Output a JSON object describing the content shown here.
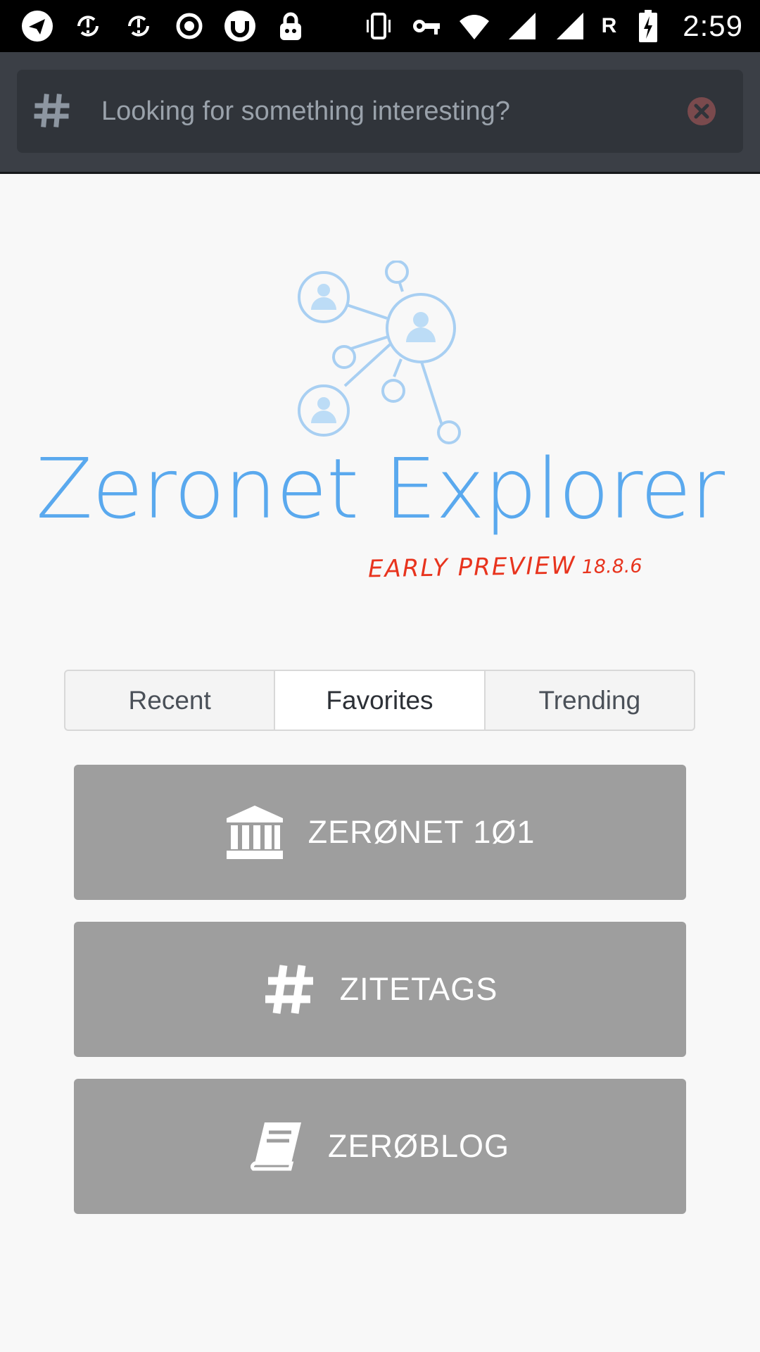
{
  "status_bar": {
    "left_icons": [
      "telegram-icon",
      "sync-icon",
      "sync-icon",
      "record-icon",
      "torrent-icon",
      "privacy-lock-icon"
    ],
    "right_icons": [
      "vibrate-icon",
      "vpn-key-icon",
      "wifi-icon",
      "cell-signal-icon",
      "cell-signal-icon",
      "battery-charging-icon"
    ],
    "roaming": "R",
    "time": "2:59"
  },
  "search": {
    "icon": "hash-icon",
    "placeholder": "Looking for something interesting?",
    "value": "",
    "clear_icon": "close-circle-icon"
  },
  "logo": {
    "title": "Zeronet Explorer",
    "subtitle": "EARLY PREVIEW",
    "version": "18.8.6",
    "graphic": "network-users-icon"
  },
  "tabs": [
    {
      "label": "Recent",
      "active": false
    },
    {
      "label": "Favorites",
      "active": true
    },
    {
      "label": "Trending",
      "active": false
    }
  ],
  "favorites": [
    {
      "label": "ZERØNET 1Ø1",
      "icon": "institution-icon"
    },
    {
      "label": "ZITETAGS",
      "icon": "hashtag-icon"
    },
    {
      "label": "ZERØBLOG",
      "icon": "book-icon"
    }
  ],
  "colors": {
    "status_bar": "#000000",
    "header": "#3b3f46",
    "search_box": "#30343a",
    "logo_blue": "#5aa9ee",
    "preview_red": "#e8341e",
    "button_gray": "#9e9e9e",
    "page_bg": "#f8f8f8"
  }
}
